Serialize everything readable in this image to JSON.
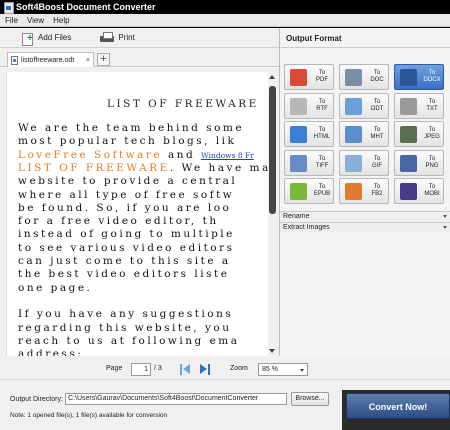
{
  "window": {
    "title": "Soft4Boost Document Converter"
  },
  "menu": [
    {
      "label": "File"
    },
    {
      "label": "View"
    },
    {
      "label": "Help"
    }
  ],
  "toolbar": {
    "add_files_label": "Add Files",
    "print_label": "Print"
  },
  "tabs": [
    {
      "label": "listoffreeware.odt",
      "close": "×"
    }
  ],
  "new_tab_symbol": "+",
  "document": {
    "title": "LIST OF FREEWARE",
    "lines": [
      [
        "We are the team behind some"
      ],
      [
        "most popular tech blogs, lik"
      ],
      [
        {
          "t": "LoveFree Software",
          "c": "orange"
        },
        {
          "t": " and "
        },
        {
          "t": "Windows 8 Fr",
          "c": "link"
        }
      ],
      [
        {
          "t": "LIST OF FREEWARE",
          "c": "orange"
        },
        {
          "t": ". We have ma"
        }
      ],
      [
        "website to provide a central"
      ],
      [
        "where all type of free softw"
      ],
      [
        "be found. So, if you are loo"
      ],
      [
        "for a free video editor, th"
      ],
      [
        "instead of going to multiple"
      ],
      [
        "to see various video editors"
      ],
      [
        "can just come to this site a"
      ],
      [
        "the best video editors liste"
      ],
      [
        "one page."
      ],
      [
        ""
      ],
      [
        "If you have any suggestions"
      ],
      [
        "regarding this website, you"
      ],
      [
        "reach to us at following ema"
      ],
      [
        "address:"
      ]
    ]
  },
  "output_format": {
    "header": "Output Format",
    "formats": [
      {
        "label": "To PDF",
        "icon": "pdf-icon",
        "color": "#d94a38",
        "active": false
      },
      {
        "label": "To DOC",
        "icon": "doc-icon",
        "color": "#7a8ea8",
        "active": false
      },
      {
        "label": "To DOCX",
        "icon": "docx-icon",
        "color": "#2b579a",
        "active": true
      },
      {
        "label": "To RTF",
        "icon": "rtf-icon",
        "color": "#b7b7b7",
        "active": false
      },
      {
        "label": "To ODT",
        "icon": "odt-icon",
        "color": "#6a9fd8",
        "active": false
      },
      {
        "label": "To TXT",
        "icon": "txt-icon",
        "color": "#9a9a9a",
        "active": false
      },
      {
        "label": "To HTML",
        "icon": "html-icon",
        "color": "#3b7fd6",
        "active": false
      },
      {
        "label": "To MHT",
        "icon": "mht-icon",
        "color": "#5a8fcf",
        "active": false
      },
      {
        "label": "To JPEG",
        "icon": "jpeg-icon",
        "color": "#5b6f4e",
        "active": false
      },
      {
        "label": "To TIFF",
        "icon": "tiff-icon",
        "color": "#6a8cc4",
        "active": false
      },
      {
        "label": "To GIF",
        "icon": "gif-icon",
        "color": "#8ab0d8",
        "active": false
      },
      {
        "label": "To PNG",
        "icon": "png-icon",
        "color": "#4a64a8",
        "active": false
      },
      {
        "label": "To EPUB",
        "icon": "epub-icon",
        "color": "#7ab83a",
        "active": false
      },
      {
        "label": "To FB2",
        "icon": "fb2-icon",
        "color": "#e07a2e",
        "active": false
      },
      {
        "label": "To MOBI",
        "icon": "mobi-icon",
        "color": "#4a3a8a",
        "active": false
      }
    ],
    "sections": [
      {
        "label": "Rename"
      },
      {
        "label": "Extract Images"
      }
    ]
  },
  "pager": {
    "label": "Page",
    "current": "1",
    "total": "/ 3",
    "zoom_label": "Zoom",
    "zoom_value": "85 %"
  },
  "output": {
    "label": "Output Directory:",
    "path": "C:\\Users\\Gaurav\\Documents\\Soft4Boost\\DocumentConverter",
    "browse_label": "Browse...",
    "convert_label": "Convert Now!"
  },
  "status": "Note: 1 opened file(s), 1 file(s) available for conversion"
}
